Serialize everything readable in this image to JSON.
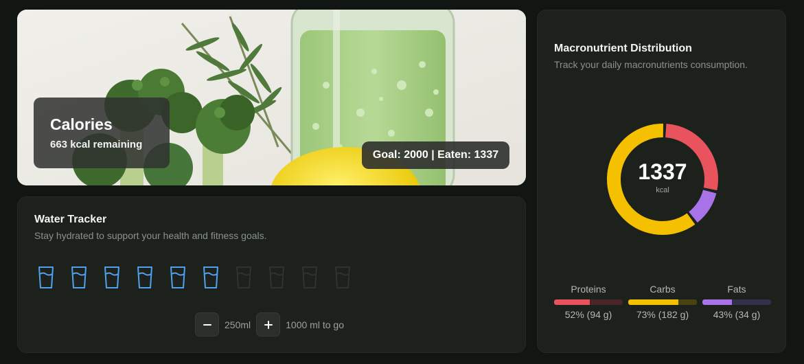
{
  "hero": {
    "title": "Calories",
    "remaining": "663 kcal remaining",
    "goal_eaten": "Goal: 2000 | Eaten: 1337"
  },
  "water": {
    "title": "Water Tracker",
    "subtitle": "Stay hydrated to support your health and fitness goals.",
    "glasses_total": 10,
    "glasses_filled": 6,
    "decrement_icon": "minus-icon",
    "increment_icon": "plus-icon",
    "amount": "250ml",
    "to_go": "1000 ml to go",
    "colors": {
      "filled": "#4ea3f0",
      "empty": "#2e332e"
    }
  },
  "macros": {
    "title": "Macronutrient Distribution",
    "subtitle": "Track your daily macronutrients consumption.",
    "total": "1337",
    "unit": "kcal",
    "segments": [
      {
        "name": "Proteins",
        "fraction": 0.28,
        "color": "#e8535e"
      },
      {
        "name": "Fats",
        "fraction": 0.11,
        "color": "#a872e8"
      },
      {
        "name": "Carbs",
        "fraction": 0.61,
        "color": "#f5c000"
      }
    ],
    "legend": [
      {
        "name": "Proteins",
        "value": "52% (94 g)",
        "percent": 52,
        "color": "#e8535e",
        "track": "#4a2528"
      },
      {
        "name": "Carbs",
        "value": "73% (182 g)",
        "percent": 73,
        "color": "#f5c000",
        "track": "#4a4210"
      },
      {
        "name": "Fats",
        "value": "43% (34 g)",
        "percent": 43,
        "color": "#a872e8",
        "track": "#32304a"
      }
    ]
  }
}
